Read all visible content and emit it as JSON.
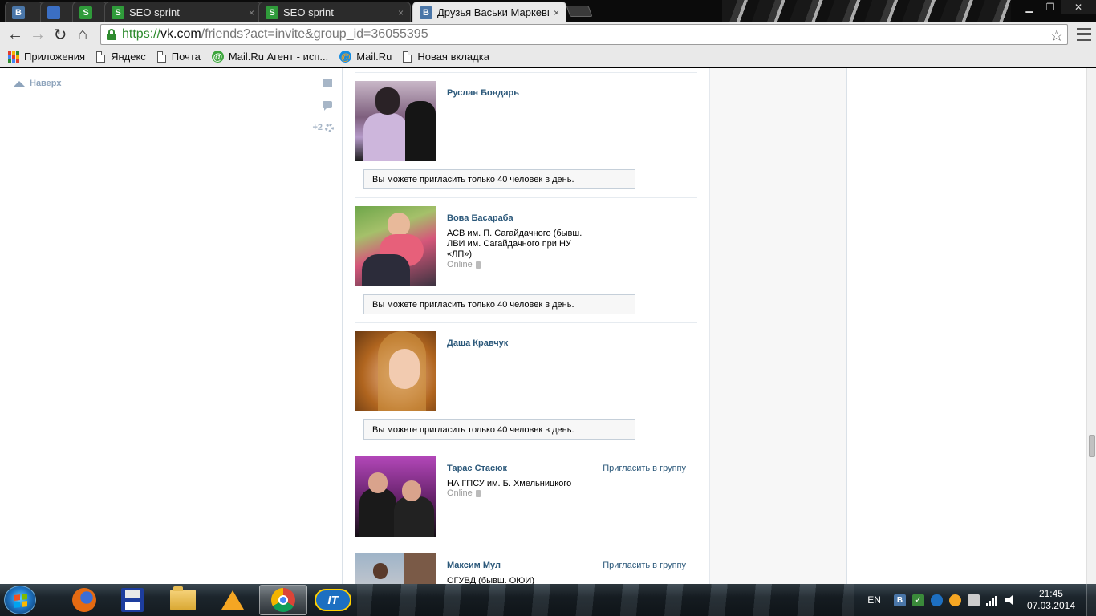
{
  "browser": {
    "tabs": [
      {
        "label": "",
        "favicon": "B",
        "favicon_type": "vk"
      },
      {
        "label": "",
        "favicon": "",
        "favicon_type": "globe"
      },
      {
        "label": "",
        "favicon": "S",
        "favicon_type": "seo"
      },
      {
        "label": "SEO sprint",
        "favicon": "S",
        "favicon_type": "seo"
      },
      {
        "label": "SEO sprint",
        "favicon": "S",
        "favicon_type": "seo"
      },
      {
        "label": "Друзья Васьки Маркевич",
        "favicon": "B",
        "favicon_type": "vk",
        "active": true
      }
    ],
    "tab_close_glyph": "×",
    "window_controls": {
      "minimize": "▁",
      "maximize": "❐",
      "close": "✕"
    },
    "nav": {
      "back": "←",
      "forward": "→",
      "reload": "↻",
      "home": "⌂"
    },
    "url": {
      "scheme": "https://",
      "host": "vk.com",
      "path": "/friends?act=invite&group_id=36055395"
    },
    "star_glyph": "☆",
    "bookmarks": [
      {
        "label": "Приложения",
        "icon": "apps-grid-icon"
      },
      {
        "label": "Яндекс",
        "icon": "page-icon"
      },
      {
        "label": "Почта",
        "icon": "page-icon"
      },
      {
        "label": "Mail.Ru Агент - исп...",
        "icon": "mailru-agent-icon"
      },
      {
        "label": "Mail.Ru",
        "icon": "mailru-icon"
      },
      {
        "label": "Новая вкладка",
        "icon": "page-icon"
      }
    ]
  },
  "page": {
    "back_to_top": "Наверх",
    "side_counter": "+2",
    "limit_message": "Вы можете пригласить только 40 человек в день.",
    "invite_label": "Пригласить в группу",
    "online_label": "Online",
    "friends": [
      {
        "name": "Руслан Бондарь",
        "uni": "",
        "online": false,
        "status": "limit"
      },
      {
        "name": "Вова Басараба",
        "uni": "АСВ им. П. Сагайдачного (бывш. ЛВИ им. Сагайдачного при НУ «ЛП»)",
        "online": true,
        "status": "limit"
      },
      {
        "name": "Даша Кравчук",
        "uni": "",
        "online": false,
        "status": "limit"
      },
      {
        "name": "Тарас Стасюк",
        "uni": "НА ГПСУ им. Б. Хмельницкого",
        "online": true,
        "status": "invite"
      },
      {
        "name": "Максим Мул",
        "uni": "ОГУВД (бывш. ОЮИ)",
        "online": false,
        "status": "invite"
      }
    ]
  },
  "taskbar": {
    "apps": [
      "firefox-icon",
      "floppy-save-icon",
      "folder-icon",
      "aimp-icon",
      "chrome-icon",
      "it-icon"
    ],
    "it_label": "IT",
    "language": "EN",
    "tray_vk": "B",
    "time": "21:45",
    "date": "07.03.2014"
  },
  "colors": {
    "vk_link": "#2b587a",
    "vk_brand": "#4a76a8",
    "secure_green": "#2e8b2e",
    "muted": "#999999"
  }
}
